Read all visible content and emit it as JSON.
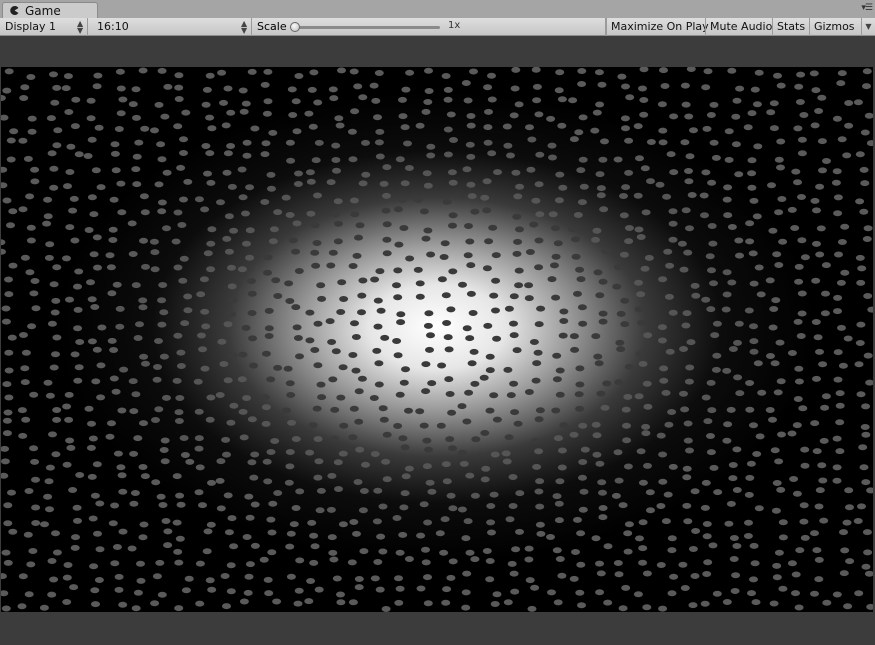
{
  "window": {
    "tab_label": "Game",
    "tab_icon": "pacman-icon",
    "menu_icon": "window-menu-icon"
  },
  "toolbar": {
    "display": "Display 1",
    "aspect": "16:10",
    "scale_label": "Scale",
    "scale_value": "1x",
    "scale_level": 0.0,
    "maximize": "Maximize On Play",
    "mute": "Mute Audio",
    "stats": "Stats",
    "gizmos": "Gizmos"
  },
  "game_view": {
    "background": "#000000",
    "glow_color": "#ffffff",
    "particle_color": "#5a5a5a",
    "description_icon": "particle-field"
  }
}
